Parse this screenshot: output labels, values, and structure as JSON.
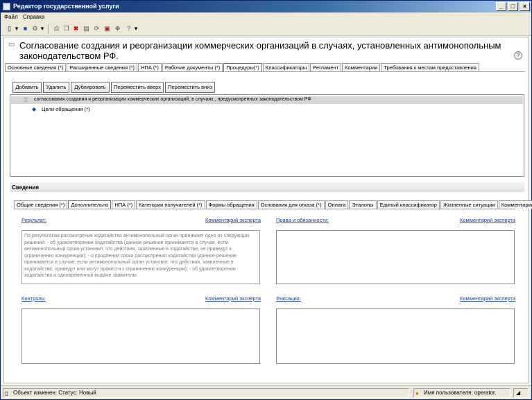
{
  "window": {
    "title": "Редактор государственной услуги",
    "controls": [
      "_",
      "□",
      "×"
    ]
  },
  "menu": [
    "Файл",
    "Справка"
  ],
  "toolbar": {
    "icons": [
      "new-document-icon",
      "save-icon",
      "settings-icon",
      "print-icon",
      "copy-icon",
      "delete-icon",
      "export-icon",
      "refresh-icon",
      "publish-icon",
      "move-icon",
      "help-icon"
    ]
  },
  "document": {
    "title": "Согласование создания и реорганизации коммерческих организаций в случаях, установленных антимонопольным законодательством РФ."
  },
  "top_tabs": [
    "Основные сведения (*)",
    "Расширенные сведения (*)",
    "НПА (*)",
    "Рабочие документы (*)",
    "Процедуры(*)",
    "Классификаторы",
    "Регламент",
    "Комментарии",
    "Требования к местам предоставления"
  ],
  "top_tabs_active": "Процедуры(*)",
  "procedure_buttons": [
    "Добавить",
    "Удалить",
    "Дублировать",
    "Переместить вверх",
    "Переместить вниз"
  ],
  "tree": {
    "row1": "согласования создания и реорганизации коммерческих организаций, в случаях., предусмотренных законодательством РФ",
    "row2": "Цели обращения (*)"
  },
  "details": {
    "heading": "Сведения",
    "tabs": [
      "Общие сведения (*)",
      "Дополнительно",
      "НПА (*)",
      "Категории получателей (*)",
      "Формы обращения",
      "Основания для отказа (*)",
      "Оплата",
      "Эталоны",
      "Единый классификатор",
      "Жизненные ситуации",
      "Комментарии"
    ],
    "active_tab": "Дополнительно",
    "result_label": "Результат:",
    "result_comment": "Комментарий эксперта",
    "result_text": "По результатам рассмотрения ходатайства антимонопольный орган принимает одно из следующих решений: - об удовлетворении ходатайства (данное решение принимается в случае, если антимонопольный орган установит, что действия, заявленные в ходатайстве, не приведут к ограничению конкуренции); - о продлении срока рассмотрения ходатайства (данное решение принимается в случае, если антимонопольный орган установит, что действия, заявленные в ходатайстве, приведут или могут привести к ограничению конкуренции); - об удовлетворении ходатайства и одновременной выдаче заявителю",
    "rights_label": "Права и обязанности:",
    "rights_comment": "Комментарий эксперта",
    "control_label": "Контроль:",
    "control_comment": "Комментарий эксперта",
    "fixation_label": "Фиксация:",
    "fixation_comment": "Комментарий эксперта"
  },
  "status": {
    "left": "Объект изменен. Статус: Новый",
    "right": "Имя пользователя: operator."
  }
}
